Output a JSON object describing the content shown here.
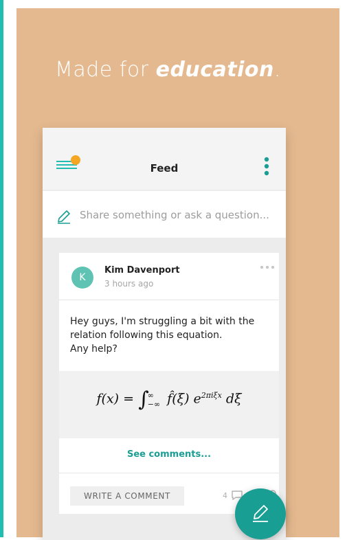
{
  "theme": {
    "teal": "#21bdb1",
    "panel": "#e5b98f",
    "fab": "#199e94",
    "avatar": "#5fc3b3",
    "badge": "#f5a623"
  },
  "hero": {
    "text_prefix": "Made for ",
    "text_emphasis": "education",
    "text_suffix": "."
  },
  "app": {
    "feed_title": "Feed",
    "menu_icon": "hamburger-menu-icon",
    "overflow_icon": "vertical-dots-icon",
    "share_placeholder": "Share something or ask a question...",
    "share_icon": "pencil-icon"
  },
  "post": {
    "avatar_letter": "K",
    "author": "Kim Davenport",
    "time": "3 hours ago",
    "more_icon": "horizontal-dots-icon",
    "body": "Hey guys, I'm struggling a bit with the\nrelation following this equation.\nAny help?",
    "see_comments": "See comments...",
    "write_comment": "WRITE A COMMENT",
    "comment_count": "4"
  },
  "fab": {
    "icon": "pencil-icon"
  }
}
